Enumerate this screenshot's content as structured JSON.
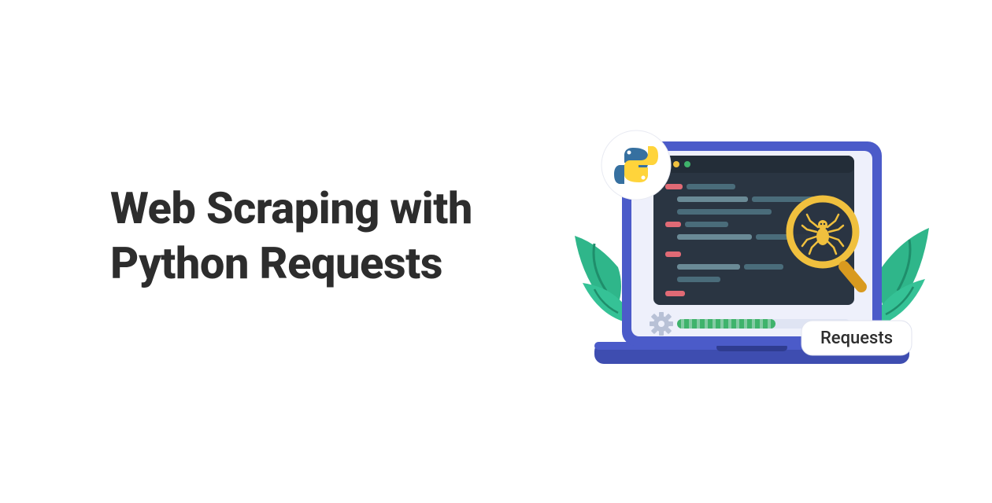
{
  "heading": {
    "line1": "Web Scraping with",
    "line2": "Python Requests"
  },
  "illustration": {
    "badge_label": "Requests",
    "python_badge": "python-logo",
    "magnifier_subject": "spider"
  },
  "colors": {
    "text": "#2d2d2d",
    "laptop_frame": "#4b5bc9",
    "laptop_base": "#3e4db0",
    "screen_bg": "#eef0fb",
    "code_bg": "#2a3542",
    "code_line_keyword": "#e06a75",
    "code_line_normal": "#4a6c7a",
    "code_line_alt": "#6a8a96",
    "leaf": "#2fb68a",
    "magnifier_ring": "#f0c03e",
    "magnifier_handle": "#d99a1f",
    "spider": "#f0c03e",
    "progress": "#3fb36c",
    "gear": "#b8c1d6",
    "badge_bg": "#ffffff",
    "badge_text": "#2d2d2d",
    "python_blue": "#3670a0",
    "python_yellow": "#ffd43b"
  }
}
